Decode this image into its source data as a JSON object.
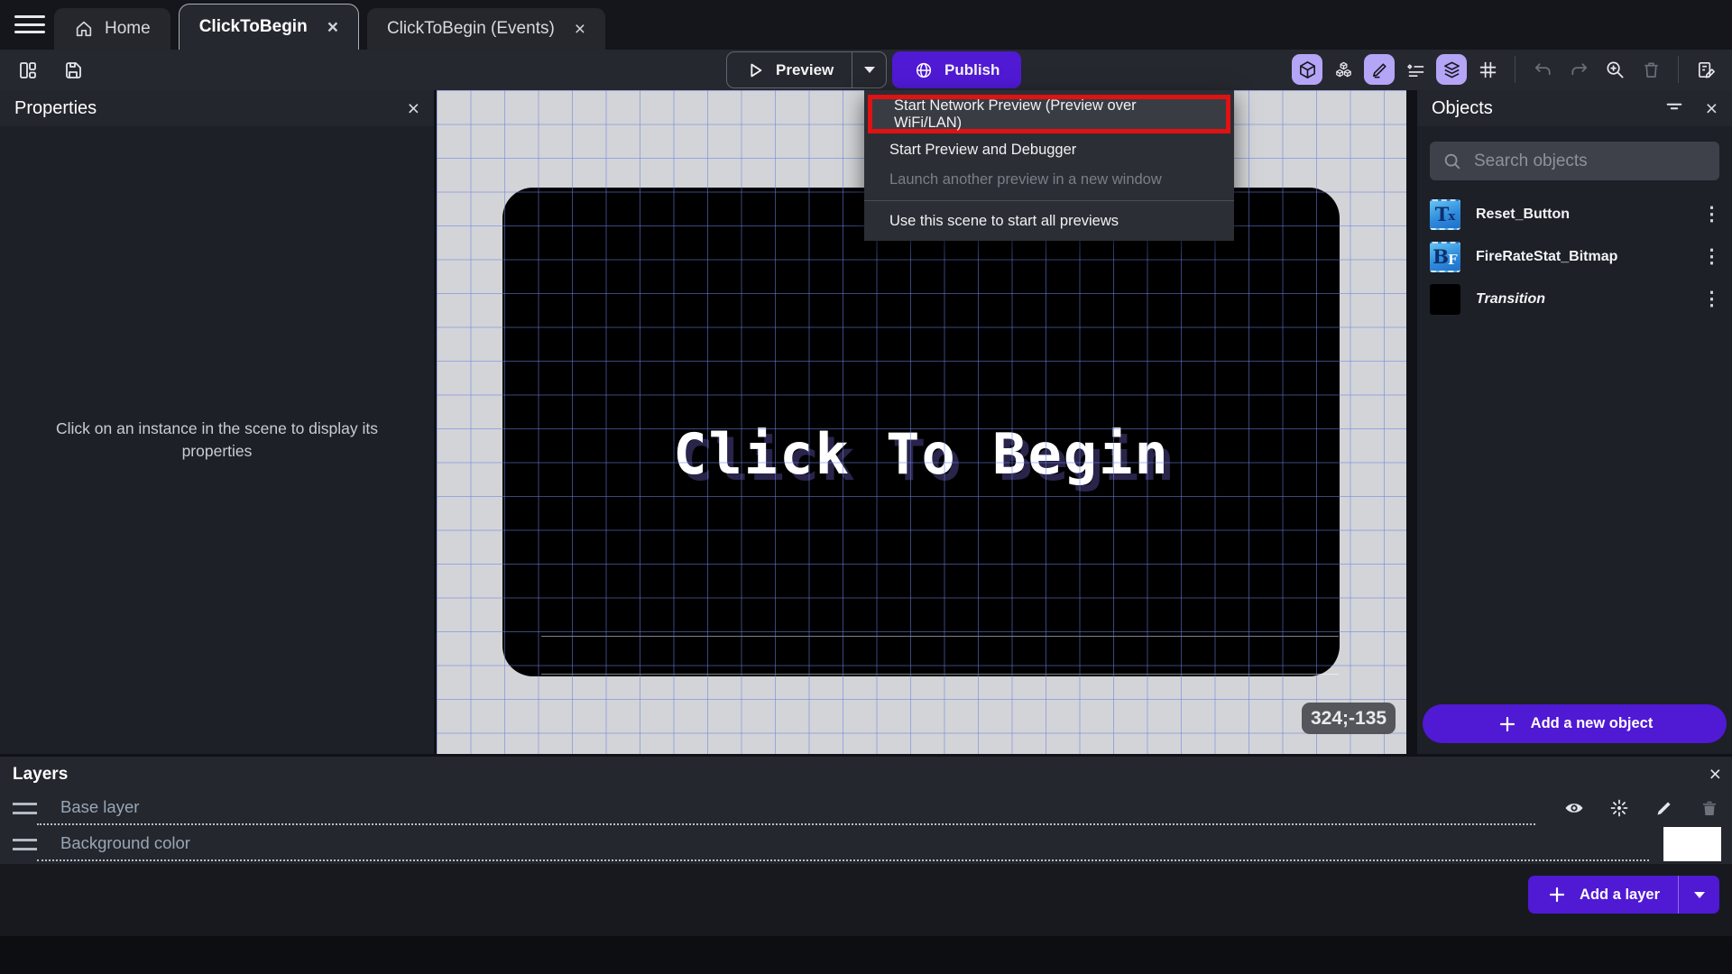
{
  "colors": {
    "accent_purple": "#5019d4",
    "active_icon_bg": "#b5a5f7",
    "highlight_red": "#e01212",
    "canvas_bg": "#d3d4d7"
  },
  "tabbar": {
    "tabs": [
      {
        "label": "Home"
      },
      {
        "label": "ClickToBegin"
      },
      {
        "label": "ClickToBegin (Events)"
      }
    ]
  },
  "toolbar": {
    "preview_label": "Preview",
    "publish_label": "Publish"
  },
  "preview_menu": {
    "items": [
      {
        "label": "Start Network Preview (Preview over WiFi/LAN)"
      },
      {
        "label": "Start Preview and Debugger"
      },
      {
        "label": "Launch another preview in a new window"
      },
      {
        "label": "Use this scene to start all previews"
      }
    ]
  },
  "properties_panel": {
    "title": "Properties",
    "empty_message": "Click on an instance in the scene to display its properties"
  },
  "scene": {
    "game_text": "Click To Begin",
    "cursor_coordinates": "324;-135"
  },
  "objects_panel": {
    "title": "Objects",
    "search_placeholder": "Search objects",
    "objects": [
      {
        "name": "Reset_Button",
        "icon_main": "T",
        "icon_sub": "x"
      },
      {
        "name": "FireRateStat_Bitmap",
        "icon_main": "B",
        "icon_sub": "F"
      },
      {
        "name": "Transition"
      }
    ],
    "add_button_label": "Add a new object"
  },
  "layers_panel": {
    "title": "Layers",
    "layers": [
      {
        "name": "Base layer"
      },
      {
        "name": "Background color"
      }
    ],
    "add_button_label": "Add a layer"
  }
}
